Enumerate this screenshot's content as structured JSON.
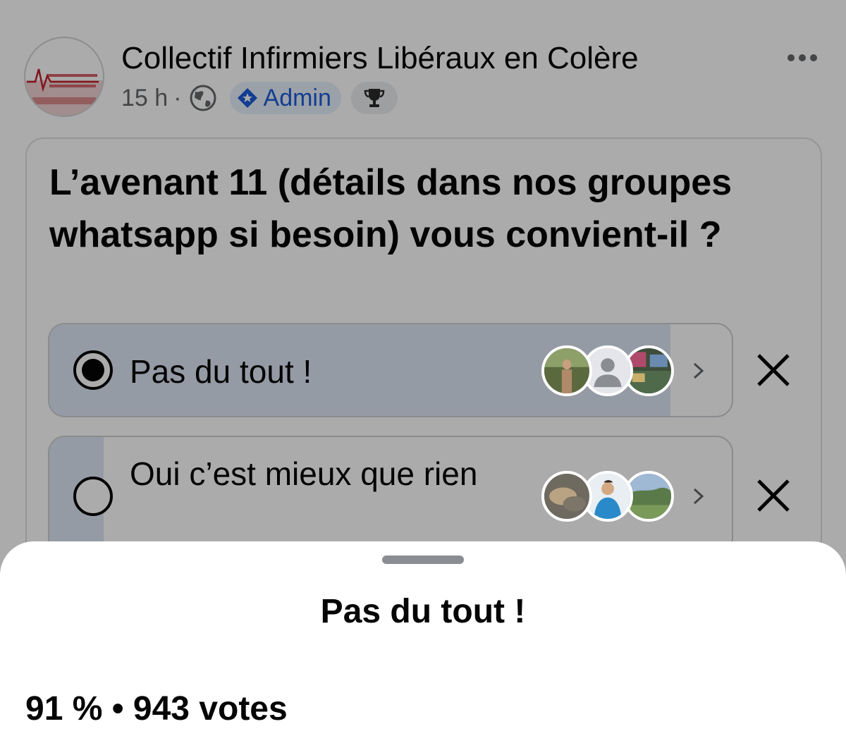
{
  "post": {
    "group_name": "Collectif Infirmiers Libéraux en Colère",
    "time": "15 h",
    "separator": "·",
    "admin_badge": "Admin",
    "avatar_icon": "group-logo-heartbeat",
    "privacy_icon": "globe-icon",
    "trophy_icon": "trophy-icon",
    "more_icon": "more-horizontal-icon"
  },
  "poll": {
    "question": "L’avenant 11 (détails dans nos groupes whatsapp si besoin) vous convient-il ?",
    "options": [
      {
        "label": "Pas du tout !",
        "selected": true,
        "share": 0.91
      },
      {
        "label": "Oui c’est mieux que rien",
        "selected": false,
        "share": 0.08
      }
    ]
  },
  "sheet": {
    "title": "Pas du tout !",
    "stats": "91 % • 943 votes"
  },
  "colors": {
    "admin_blue": "#1b5bd8",
    "poll_fill": "#dfe8f6",
    "overlay": "rgba(0,0,0,0.33)"
  }
}
